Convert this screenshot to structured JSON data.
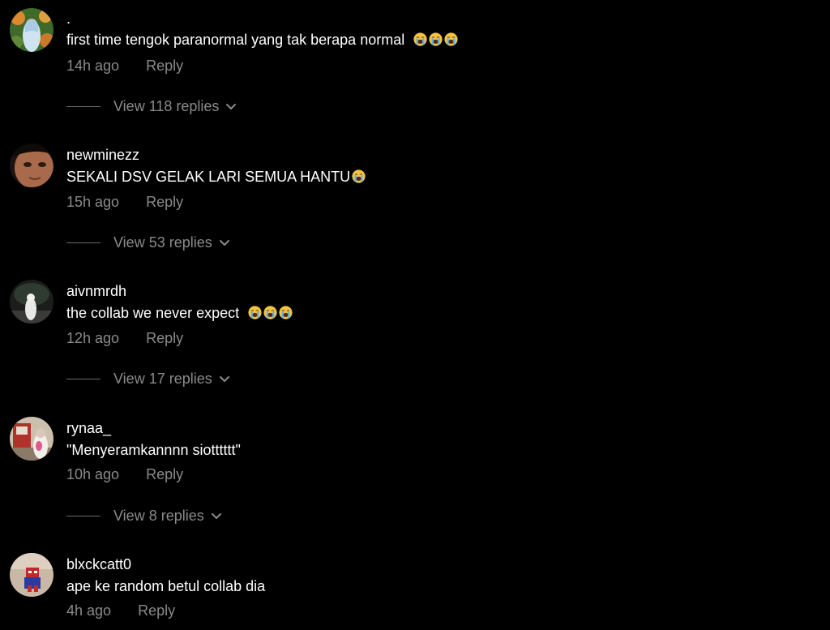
{
  "colors": {
    "background": "#000000",
    "username": "#ffffff",
    "text": "#ffffff",
    "muted": "#8a8a8a"
  },
  "comments": [
    {
      "username": ".",
      "text": "first time tengok paranormal yang tak berapa normal",
      "emoji": [
        "loudly-crying-face",
        "loudly-crying-face",
        "loudly-crying-face"
      ],
      "time": "14h ago",
      "reply_label": "Reply",
      "view_replies": "View 118 replies"
    },
    {
      "username": "newminezz",
      "text": "SEKALI DSV GELAK LARI SEMUA HANTU",
      "emoji": [
        "loudly-crying-face"
      ],
      "time": "15h ago",
      "reply_label": "Reply",
      "view_replies": "View 53 replies"
    },
    {
      "username": "aivnmrdh",
      "text": "the collab we never expect",
      "emoji": [
        "loudly-crying-face",
        "loudly-crying-face",
        "loudly-crying-face"
      ],
      "time": "12h ago",
      "reply_label": "Reply",
      "view_replies": "View 17 replies"
    },
    {
      "username": "rynaa_",
      "text": "\"Menyeramkannnn siotttttt\"",
      "emoji": [],
      "time": "10h ago",
      "reply_label": "Reply",
      "view_replies": "View 8 replies"
    },
    {
      "username": "blxckcatt0",
      "text": "ape ke random betul collab dia",
      "emoji": [],
      "time": "4h ago",
      "reply_label": "Reply",
      "view_replies": ""
    }
  ]
}
